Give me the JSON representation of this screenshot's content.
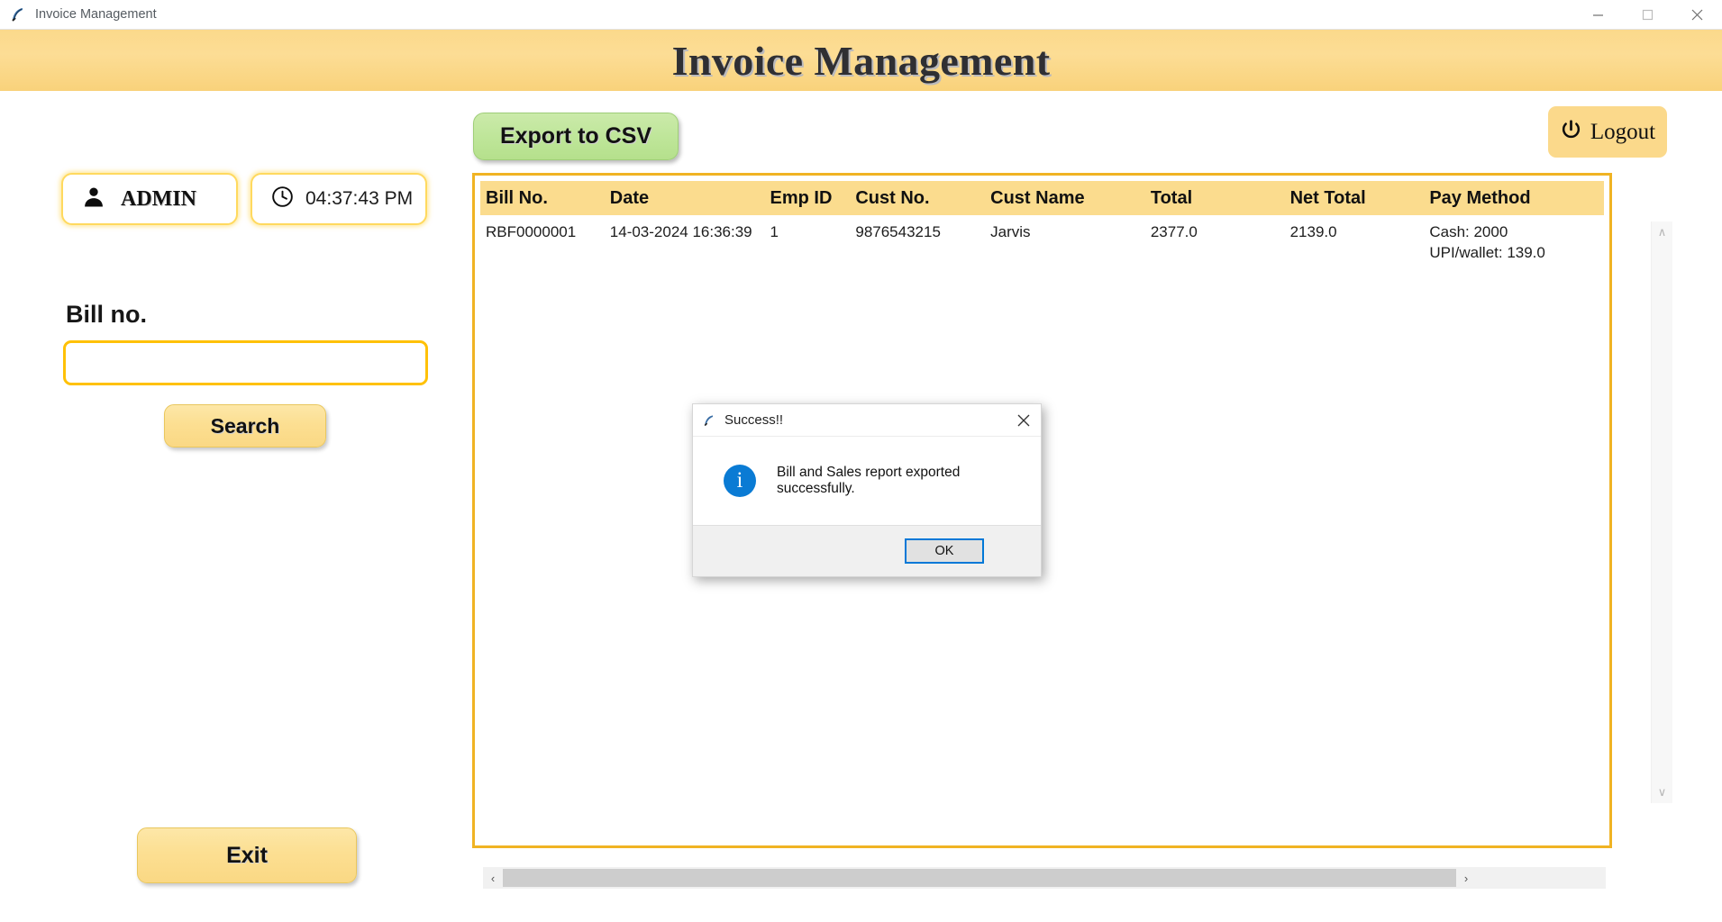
{
  "window": {
    "title": "Invoice Management",
    "app_icon": "feather-icon",
    "controls": {
      "minimize": "minimize-icon",
      "maximize": "maximize-icon",
      "close": "close-icon"
    }
  },
  "banner": {
    "title": "Invoice Management"
  },
  "sidebar": {
    "user_badge": {
      "icon": "user-icon",
      "label": "ADMIN"
    },
    "clock_badge": {
      "icon": "clock-icon",
      "label": "04:37:43 PM"
    },
    "bill_label": "Bill no.",
    "bill_input_value": "",
    "bill_input_placeholder": "",
    "search_button": "Search",
    "exit_button": "Exit"
  },
  "toolbar": {
    "export_button": "Export to CSV",
    "logout_button": "Logout",
    "logout_icon": "power-icon"
  },
  "table": {
    "columns": [
      "Bill No.",
      "Date",
      "Emp ID",
      "Cust No.",
      "Cust Name",
      "Total",
      "Net Total",
      "Pay Method"
    ],
    "rows": [
      {
        "bill_no": "RBF0000001",
        "date": "14-03-2024 16:36:39",
        "emp_id": "1",
        "cust_no": "9876543215",
        "cust_name": "Jarvis",
        "total": "2377.0",
        "net_total": "2139.0",
        "pay_method": "Cash: 2000\nUPI/wallet: 139.0"
      }
    ]
  },
  "scrollbars": {
    "vertical": {
      "up": "∧",
      "down": "∨"
    },
    "horizontal": {
      "left": "‹",
      "right": "›",
      "thumb_percent": 88
    }
  },
  "dialog": {
    "icon": "feather-icon",
    "title": "Success!!",
    "close_icon": "close-icon",
    "info_icon": "info-icon",
    "info_glyph": "i",
    "message": "Bill and Sales report exported successfully.",
    "ok_button": "OK"
  },
  "colors": {
    "banner_amber": "#fbd98b",
    "border_gold": "#f0b323",
    "header_band": "#fbdc8e",
    "export_green": "#bfe69a",
    "info_blue": "#0a7bd4",
    "focus_blue": "#0078d7"
  }
}
